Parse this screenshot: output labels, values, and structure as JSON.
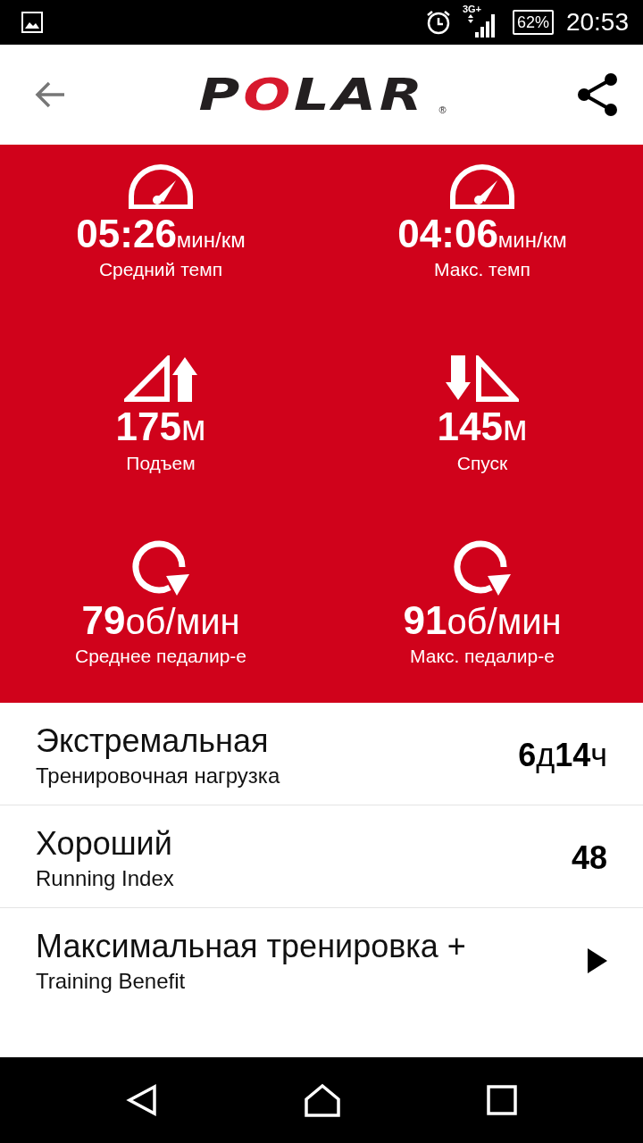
{
  "status_bar": {
    "network": "3G+",
    "battery": "62%",
    "time": "20:53"
  },
  "header": {
    "logo": "POLAR",
    "logo_mark": "®"
  },
  "stats": [
    {
      "kind": "speed",
      "value": "05:26",
      "unit": "мин/км",
      "label": "Средний темп"
    },
    {
      "kind": "speed",
      "value": "04:06",
      "unit": "мин/км",
      "label": "Макс. темп"
    },
    {
      "kind": "ascent",
      "value": "175",
      "unit": "м",
      "label": "Подъем"
    },
    {
      "kind": "descent",
      "value": "145",
      "unit": "м",
      "label": "Спуск"
    },
    {
      "kind": "cadence",
      "value": "79",
      "unit": "об/мин",
      "label": "Среднее педалир-е"
    },
    {
      "kind": "cadence",
      "value": "91",
      "unit": "об/мин",
      "label": "Макс. педалир-е"
    }
  ],
  "summary": [
    {
      "title": "Экстремальная",
      "subtitle": "Тренировочная нагрузка",
      "value": "**6**д**14**ч"
    },
    {
      "title": "Хороший",
      "subtitle": "Running Index",
      "value": "**48**"
    },
    {
      "title": "Максимальная тренировка +",
      "subtitle": "Training Benefit",
      "expandable": true
    }
  ]
}
